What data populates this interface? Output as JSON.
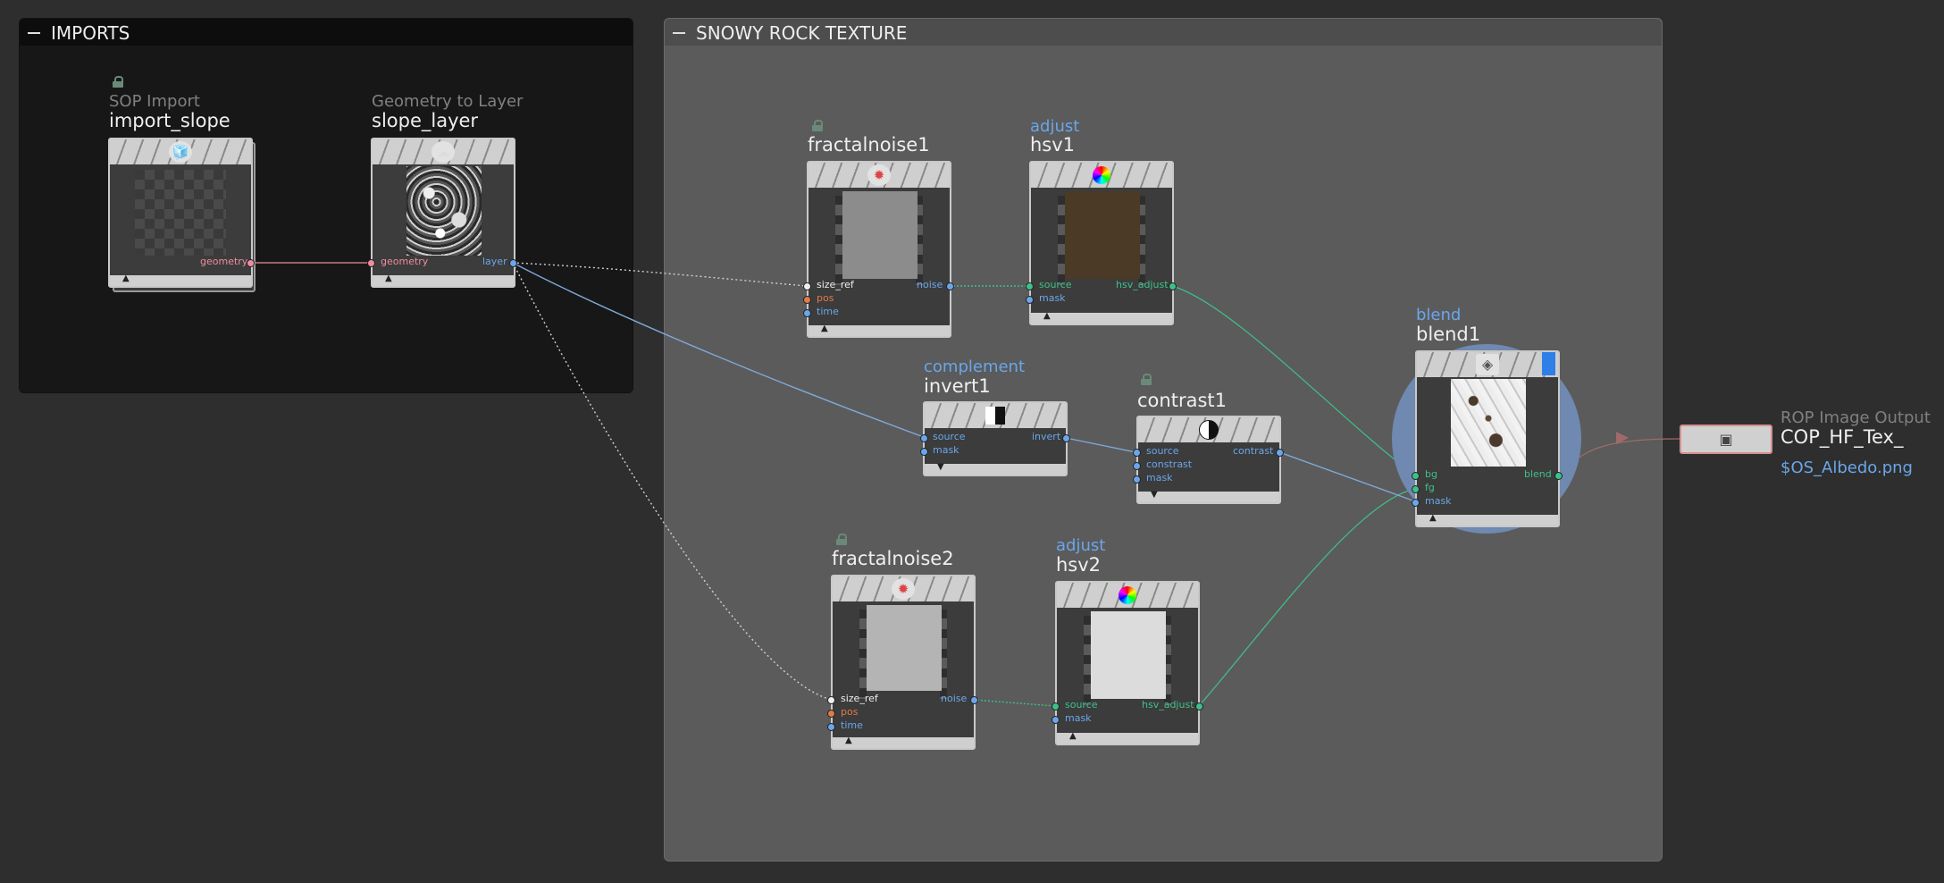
{
  "network_boxes": {
    "imports": {
      "title": "IMPORTS"
    },
    "snowy": {
      "title": "SNOWY ROCK TEXTURE"
    }
  },
  "nodes": {
    "import_slope": {
      "type_label": "SOP Import",
      "name": "import_slope",
      "icon": "cube-icon",
      "outputs": [
        "geometry"
      ]
    },
    "slope_layer": {
      "type_label": "Geometry to Layer",
      "name": "slope_layer",
      "icon": "geometry-layer-icon",
      "inputs": [
        "geometry"
      ],
      "outputs": [
        "layer"
      ]
    },
    "fractalnoise1": {
      "name": "fractalnoise1",
      "icon": "noise-icon",
      "locked": true,
      "inputs": [
        "size_ref",
        "pos",
        "time"
      ],
      "outputs": [
        "noise"
      ]
    },
    "hsv1": {
      "type_label": "adjust",
      "name": "hsv1",
      "icon": "color-wheel-icon",
      "inputs": [
        "source",
        "mask"
      ],
      "outputs": [
        "hsv_adjust"
      ]
    },
    "invert1": {
      "type_label": "complement",
      "name": "invert1",
      "icon": "invert-icon",
      "inputs": [
        "source",
        "mask"
      ],
      "outputs": [
        "invert"
      ]
    },
    "contrast1": {
      "name": "contrast1",
      "icon": "contrast-icon",
      "locked": true,
      "inputs": [
        "source",
        "constrast",
        "mask"
      ],
      "outputs": [
        "contrast"
      ]
    },
    "blend1": {
      "type_label": "blend",
      "name": "blend1",
      "icon": "layers-icon",
      "inputs": [
        "bg",
        "fg",
        "mask"
      ],
      "outputs": [
        "blend"
      ]
    },
    "fractalnoise2": {
      "name": "fractalnoise2",
      "icon": "noise-icon",
      "locked": true,
      "inputs": [
        "size_ref",
        "pos",
        "time"
      ],
      "outputs": [
        "noise"
      ]
    },
    "hsv2": {
      "type_label": "adjust",
      "name": "hsv2",
      "icon": "color-wheel-icon",
      "inputs": [
        "source",
        "mask"
      ],
      "outputs": [
        "hsv_adjust"
      ]
    },
    "rop": {
      "type_label": "ROP Image Output",
      "name": "COP_HF_Tex_",
      "path": "$OS_Albedo.png",
      "icon": "render-icon"
    }
  },
  "colors": {
    "background": "#2e2e2e",
    "imports_box": "#171717",
    "snowy_box": "#5b5b5b",
    "accent_blue": "#6aa6ea",
    "wire_green": "#3ec08a",
    "wire_pink": "#ee8ca0",
    "blend_halo": "#6f89b0",
    "brown_output": "#4a3a26"
  }
}
